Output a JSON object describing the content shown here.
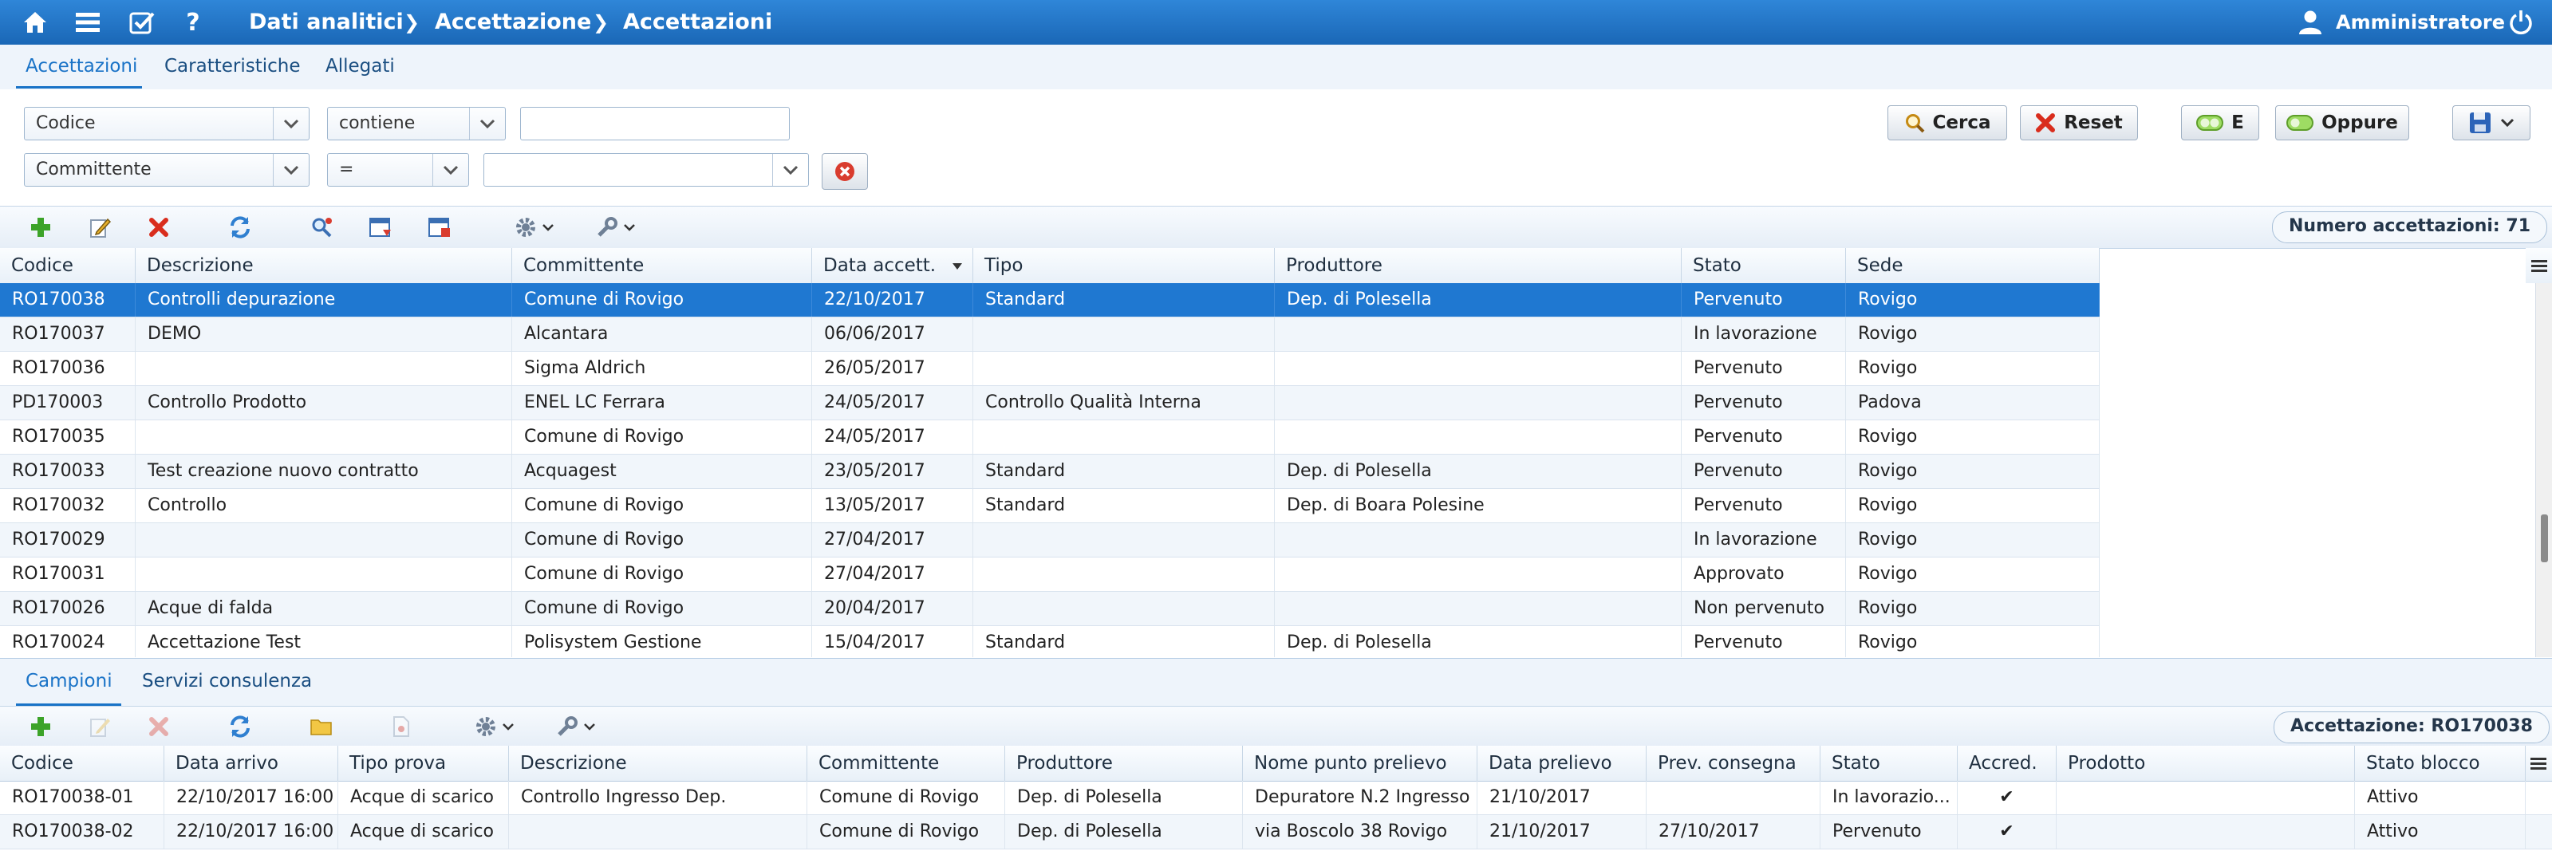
{
  "topbar": {
    "breadcrumb": [
      "Dati analitici",
      "Accettazione",
      "Accettazioni"
    ],
    "user": "Amministratore"
  },
  "main_tabs": [
    "Accettazioni",
    "Caratteristiche",
    "Allegati"
  ],
  "filters": {
    "row1": {
      "field": "Codice",
      "operator": "contiene",
      "value": ""
    },
    "row2": {
      "field": "Committente",
      "operator": "=",
      "value": ""
    },
    "buttons": {
      "search": "Cerca",
      "reset": "Reset",
      "and": "E",
      "or": "Oppure"
    }
  },
  "toolbar": {
    "count_label": "Numero accettazioni: 71"
  },
  "accettazioni": {
    "columns": [
      "Codice",
      "Descrizione",
      "Committente",
      "Data accett.",
      "Tipo",
      "Produttore",
      "Stato",
      "Sede"
    ],
    "rows": [
      [
        "RO170038",
        "Controlli depurazione",
        "Comune di Rovigo",
        "22/10/2017",
        "Standard",
        "Dep. di Polesella",
        "Pervenuto",
        "Rovigo"
      ],
      [
        "RO170037",
        "DEMO",
        "Alcantara",
        "06/06/2017",
        "",
        "",
        "In lavorazione",
        "Rovigo"
      ],
      [
        "RO170036",
        "",
        "Sigma Aldrich",
        "26/05/2017",
        "",
        "",
        "Pervenuto",
        "Rovigo"
      ],
      [
        "PD170003",
        "Controllo Prodotto",
        "ENEL LC Ferrara",
        "24/05/2017",
        "Controllo Qualità Interna",
        "",
        "Pervenuto",
        "Padova"
      ],
      [
        "RO170035",
        "",
        "Comune di Rovigo",
        "24/05/2017",
        "",
        "",
        "Pervenuto",
        "Rovigo"
      ],
      [
        "RO170033",
        "Test creazione nuovo contratto",
        "Acquagest",
        "23/05/2017",
        "Standard",
        "Dep. di Polesella",
        "Pervenuto",
        "Rovigo"
      ],
      [
        "RO170032",
        "Controllo",
        "Comune di Rovigo",
        "13/05/2017",
        "Standard",
        "Dep. di Boara Polesine",
        "Pervenuto",
        "Rovigo"
      ],
      [
        "RO170029",
        "",
        "Comune di Rovigo",
        "27/04/2017",
        "",
        "",
        "In lavorazione",
        "Rovigo"
      ],
      [
        "RO170031",
        "",
        "Comune di Rovigo",
        "27/04/2017",
        "",
        "",
        "Approvato",
        "Rovigo"
      ],
      [
        "RO170026",
        "Acque di falda",
        "Comune di Rovigo",
        "20/04/2017",
        "",
        "",
        "Non pervenuto",
        "Rovigo"
      ],
      [
        "RO170024",
        "Accettazione Test",
        "Polisystem Gestione",
        "15/04/2017",
        "Standard",
        "Dep. di Polesella",
        "Pervenuto",
        "Rovigo"
      ]
    ]
  },
  "lower_tabs": [
    "Campioni",
    "Servizi consulenza"
  ],
  "lower_toolbar": {
    "label": "Accettazione: RO170038"
  },
  "campioni": {
    "columns": [
      "Codice",
      "Data arrivo",
      "Tipo prova",
      "Descrizione",
      "Committente",
      "Produttore",
      "Nome punto prelievo",
      "Data prelievo",
      "Prev. consegna",
      "Stato",
      "Accred.",
      "Prodotto",
      "Stato blocco"
    ],
    "rows": [
      [
        "RO170038-01",
        "22/10/2017 16:00",
        "Acque di scarico",
        "Controllo Ingresso Dep.",
        "Comune di Rovigo",
        "Dep. di Polesella",
        "Depuratore N.2 Ingresso",
        "21/10/2017",
        "",
        "In lavorazio...",
        "✔",
        "",
        "Attivo"
      ],
      [
        "RO170038-02",
        "22/10/2017 16:00",
        "Acque di scarico",
        "",
        "Comune di Rovigo",
        "Dep. di Polesella",
        "via Boscolo 38 Rovigo",
        "21/10/2017",
        "27/10/2017",
        "Pervenuto",
        "✔",
        "",
        "Attivo"
      ]
    ]
  }
}
